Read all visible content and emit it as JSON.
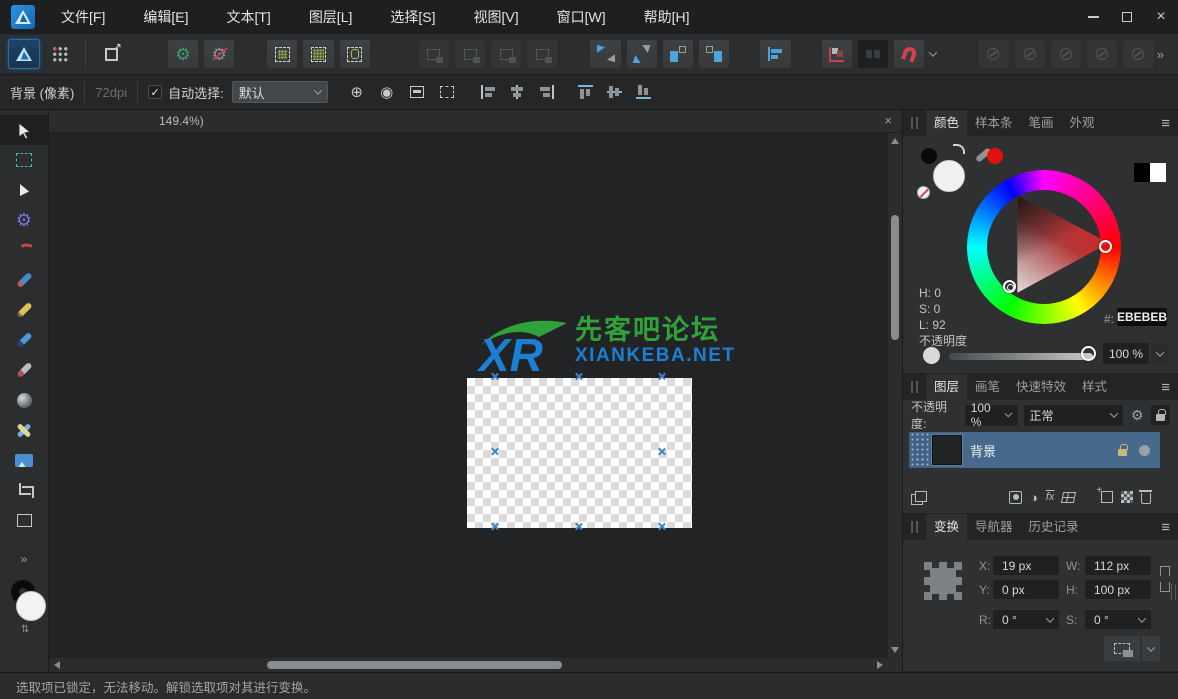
{
  "titlebar": {
    "menus": [
      "文件[F]",
      "编辑[E]",
      "文本[T]",
      "图层[L]",
      "选择[S]",
      "视图[V]",
      "窗口[W]",
      "帮助[H]"
    ]
  },
  "toolbar": {
    "buttons": [
      "designer-persona",
      "pixel-persona",
      "export-persona",
      "snap-gear-on",
      "snap-gear-off",
      "select-grid-dots",
      "select-dense-dots",
      "select-object-dots",
      "insert-disabled-1",
      "insert-disabled-2",
      "insert-disabled-3",
      "insert-disabled-4",
      "flip-horizontal",
      "flip-vertical",
      "rotate-ccw",
      "rotate-cw",
      "alignment",
      "pixel-align",
      "force-pixel-align-off",
      "snapping-magnet",
      "snapping-options",
      "disabled-1",
      "disabled-2",
      "disabled-3",
      "disabled-4",
      "disabled-5",
      "more-chevron"
    ]
  },
  "context_toolbar": {
    "selection_label": "背景 (像素)",
    "dpi": "72dpi",
    "auto_select_label": "自动选择:",
    "auto_select_value": "默认",
    "icons": [
      "transform-origin",
      "cycle-selection-box",
      "edit-all-layers",
      "marquee-mode",
      "align-left",
      "align-center-h",
      "align-right",
      "align-top",
      "align-middle-v",
      "align-bottom"
    ]
  },
  "tool_strip": {
    "tools": [
      "move-tool",
      "marquee-selection-tool",
      "node-tool",
      "point-transform-tool",
      "corner-tool",
      "pen-tool",
      "pencil-tool",
      "vector-brush-tool",
      "knife-tool",
      "fill-tool",
      "transparency-tool",
      "place-image-tool",
      "crop-tool",
      "shape-tool",
      "more-tools",
      "fill-stroke-swatches",
      "swap-colors"
    ]
  },
  "document_tab": {
    "title": "149.4%)"
  },
  "canvas": {
    "watermark": {
      "mark": "XR",
      "title": "先客吧论坛",
      "subtitle": "XIANKEBA.NET"
    }
  },
  "panels": {
    "color": {
      "tabs": [
        "颜色",
        "样本条",
        "笔画",
        "外观"
      ],
      "hsl": [
        "H: 0",
        "S: 0",
        "L: 92"
      ],
      "hex_label": "#:",
      "hex": "EBEBEB",
      "opacity_label": "不透明度",
      "opacity": "100 %"
    },
    "layers": {
      "tabs": [
        "图层",
        "画笔",
        "快速特效",
        "样式"
      ],
      "opacity_label": "不透明度:",
      "opacity": "100 %",
      "blend": "正常",
      "layer_name": "背景"
    },
    "transform": {
      "tabs": [
        "变换",
        "导航器",
        "历史记录"
      ],
      "x_label": "X:",
      "x_value": "19 px",
      "y_label": "Y:",
      "y_value": "0 px",
      "w_label": "W:",
      "w_value": "112 px",
      "h_label": "H:",
      "h_value": "100 px",
      "r_label": "R:",
      "r_value": "0 °",
      "s_label": "S:",
      "s_value": "0 °"
    }
  },
  "status_bar": {
    "message": "选取项已锁定，无法移动。解锁选取项对其进行变换。"
  },
  "colors": {
    "accent_blue": "#4da3dc",
    "selected_layer_blue": "#47698b",
    "magnet_red": "#d8404f",
    "logo_green": "#2fa33a",
    "logo_blue": "#1c7fd6",
    "current_color_hex": "#EBEBEB"
  }
}
